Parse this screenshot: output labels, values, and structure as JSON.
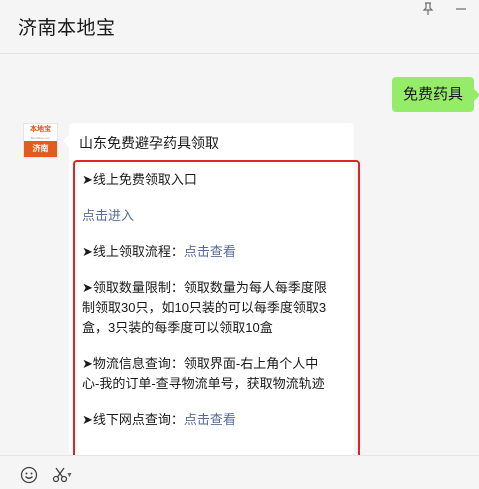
{
  "window": {
    "title": "济南本地宝",
    "pin_icon": "pin-icon",
    "minimize_icon": "minimize-icon"
  },
  "chat": {
    "sent_message": "免费药具",
    "avatar": {
      "top_text": "本地宝",
      "sub_text": "Bendibao.com",
      "bottom_text": "济南"
    },
    "reply": {
      "title": "山东免费避孕药具领取",
      "sections": [
        {
          "lines": [
            "➤线上免费领取入口"
          ]
        },
        {
          "link": "点击进入"
        },
        {
          "label": "➤线上领取流程：",
          "link": "点击查看"
        },
        {
          "lines": [
            "➤领取数量限制：领取数量为每人每季度限",
            "制领取30只，如10只装的可以每季度领取3",
            "盒，3只装的每季度可以领取10盒"
          ]
        },
        {
          "lines": [
            "➤物流信息查询：领取界面-右上角个人中",
            "心-我的订单-查寻物流单号，获取物流轨迹"
          ]
        },
        {
          "label": "➤线下网点查询：",
          "link": "点击查看"
        }
      ]
    }
  },
  "toolbar": {
    "emoji_icon": "emoji-icon",
    "screenshot_icon": "scissors-icon"
  },
  "colors": {
    "sent_bubble": "#95ec69",
    "link": "#576b95",
    "highlight_border": "#e32222"
  }
}
